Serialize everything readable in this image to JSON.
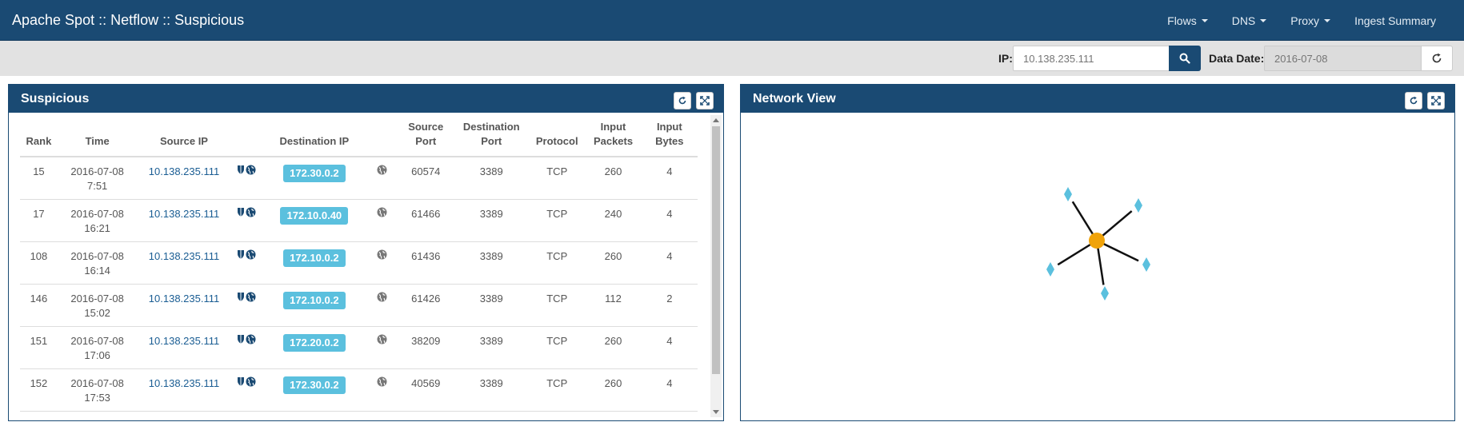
{
  "app": {
    "title": "Apache Spot :: Netflow :: Suspicious",
    "nav": [
      {
        "label": "Flows",
        "has_caret": true
      },
      {
        "label": "DNS",
        "has_caret": true
      },
      {
        "label": "Proxy",
        "has_caret": true
      },
      {
        "label": "Ingest Summary",
        "has_caret": false
      }
    ]
  },
  "toolbar": {
    "ip_label": "IP:",
    "ip_placeholder": "10.138.235.111",
    "date_label": "Data Date:",
    "date_placeholder": "2016-07-08"
  },
  "suspicious": {
    "title": "Suspicious",
    "columns": [
      "Rank",
      "Time",
      "Source IP",
      "",
      "Destination IP",
      "",
      "Source Port",
      "Destination Port",
      "Protocol",
      "Input Packets",
      "Input Bytes"
    ],
    "rows": [
      {
        "rank": "15",
        "date": "2016-07-08",
        "time": "7:51",
        "src": "10.138.235.111",
        "dst": "172.30.0.2",
        "sport": "60574",
        "dport": "3389",
        "proto": "TCP",
        "packets": "260",
        "bytes": "4"
      },
      {
        "rank": "17",
        "date": "2016-07-08",
        "time": "16:21",
        "src": "10.138.235.111",
        "dst": "172.10.0.40",
        "sport": "61466",
        "dport": "3389",
        "proto": "TCP",
        "packets": "240",
        "bytes": "4"
      },
      {
        "rank": "108",
        "date": "2016-07-08",
        "time": "16:14",
        "src": "10.138.235.111",
        "dst": "172.10.0.2",
        "sport": "61436",
        "dport": "3389",
        "proto": "TCP",
        "packets": "260",
        "bytes": "4"
      },
      {
        "rank": "146",
        "date": "2016-07-08",
        "time": "15:02",
        "src": "10.138.235.111",
        "dst": "172.10.0.2",
        "sport": "61426",
        "dport": "3389",
        "proto": "TCP",
        "packets": "112",
        "bytes": "2"
      },
      {
        "rank": "151",
        "date": "2016-07-08",
        "time": "17:06",
        "src": "10.138.235.111",
        "dst": "172.20.0.2",
        "sport": "38209",
        "dport": "3389",
        "proto": "TCP",
        "packets": "260",
        "bytes": "4"
      },
      {
        "rank": "152",
        "date": "2016-07-08",
        "time": "17:53",
        "src": "10.138.235.111",
        "dst": "172.30.0.2",
        "sport": "40569",
        "dport": "3389",
        "proto": "TCP",
        "packets": "260",
        "bytes": "4"
      }
    ]
  },
  "network": {
    "title": "Network View",
    "center_color": "#f0a30a",
    "leaf_color": "#5bc0de",
    "leaf_count": 5
  },
  "colors": {
    "navbar": "#1a4a73",
    "accent": "#5bc0de",
    "link": "#1a5d93"
  }
}
